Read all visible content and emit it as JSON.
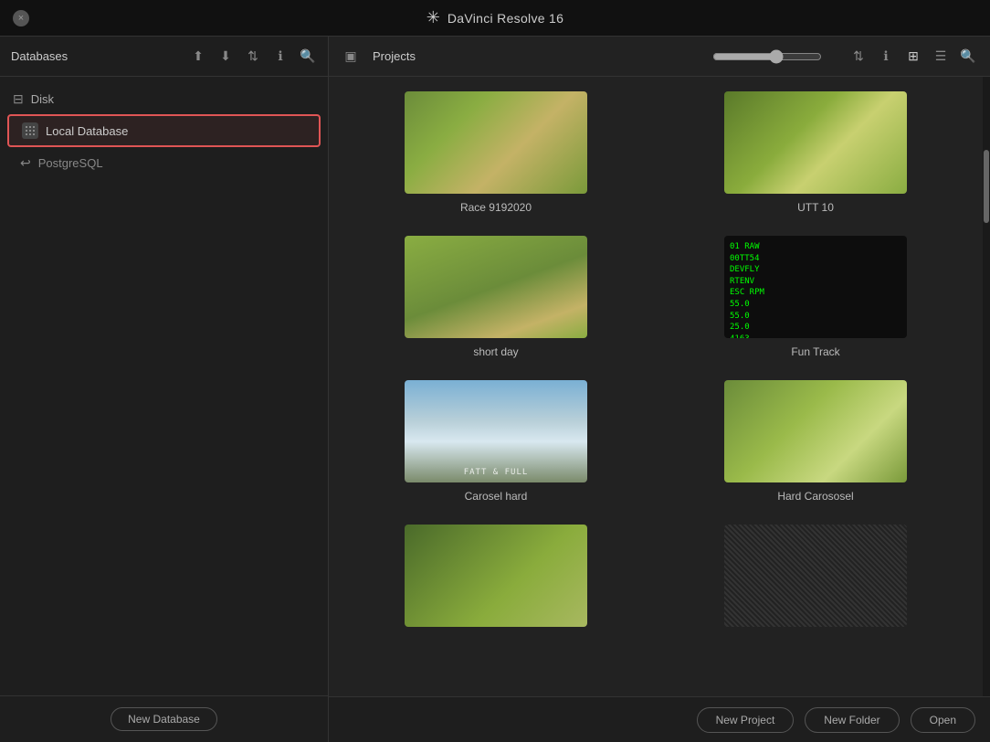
{
  "titlebar": {
    "close_label": "×",
    "title": "DaVinci Resolve 16",
    "logo": "✳"
  },
  "sidebar": {
    "title": "Databases",
    "icons": {
      "upload": "⬆",
      "download": "⬇",
      "sort": "⇅",
      "info": "ℹ",
      "search": "🔍"
    },
    "disk_label": "Disk",
    "local_db_label": "Local Database",
    "postgres_label": "PostgreSQL",
    "footer_btn": "New Database"
  },
  "right_panel": {
    "panel_icon": "▣",
    "title": "Projects",
    "slider_value": 60,
    "icons": {
      "sort": "⇅",
      "info": "ℹ",
      "grid": "⊞",
      "list": "☰",
      "search": "🔍"
    },
    "footer_btns": {
      "new_project": "New Project",
      "new_folder": "New Folder",
      "open": "Open"
    }
  },
  "projects": [
    {
      "id": 1,
      "name": "Race 9192020",
      "thumb_class": "thumb-race"
    },
    {
      "id": 2,
      "name": "UTT 10",
      "thumb_class": "thumb-utt"
    },
    {
      "id": 3,
      "name": "short day",
      "thumb_class": "thumb-short"
    },
    {
      "id": 4,
      "name": "Fun Track",
      "thumb_class": "thumb-fun",
      "special": "fun-track"
    },
    {
      "id": 5,
      "name": "Carosel hard",
      "thumb_class": "thumb-carosel",
      "special": "carosel"
    },
    {
      "id": 6,
      "name": "Hard Carososel",
      "thumb_class": "thumb-hard"
    },
    {
      "id": 7,
      "name": "",
      "thumb_class": "thumb-partial1"
    },
    {
      "id": 8,
      "name": "",
      "thumb_class": "thumb-partial2"
    }
  ]
}
